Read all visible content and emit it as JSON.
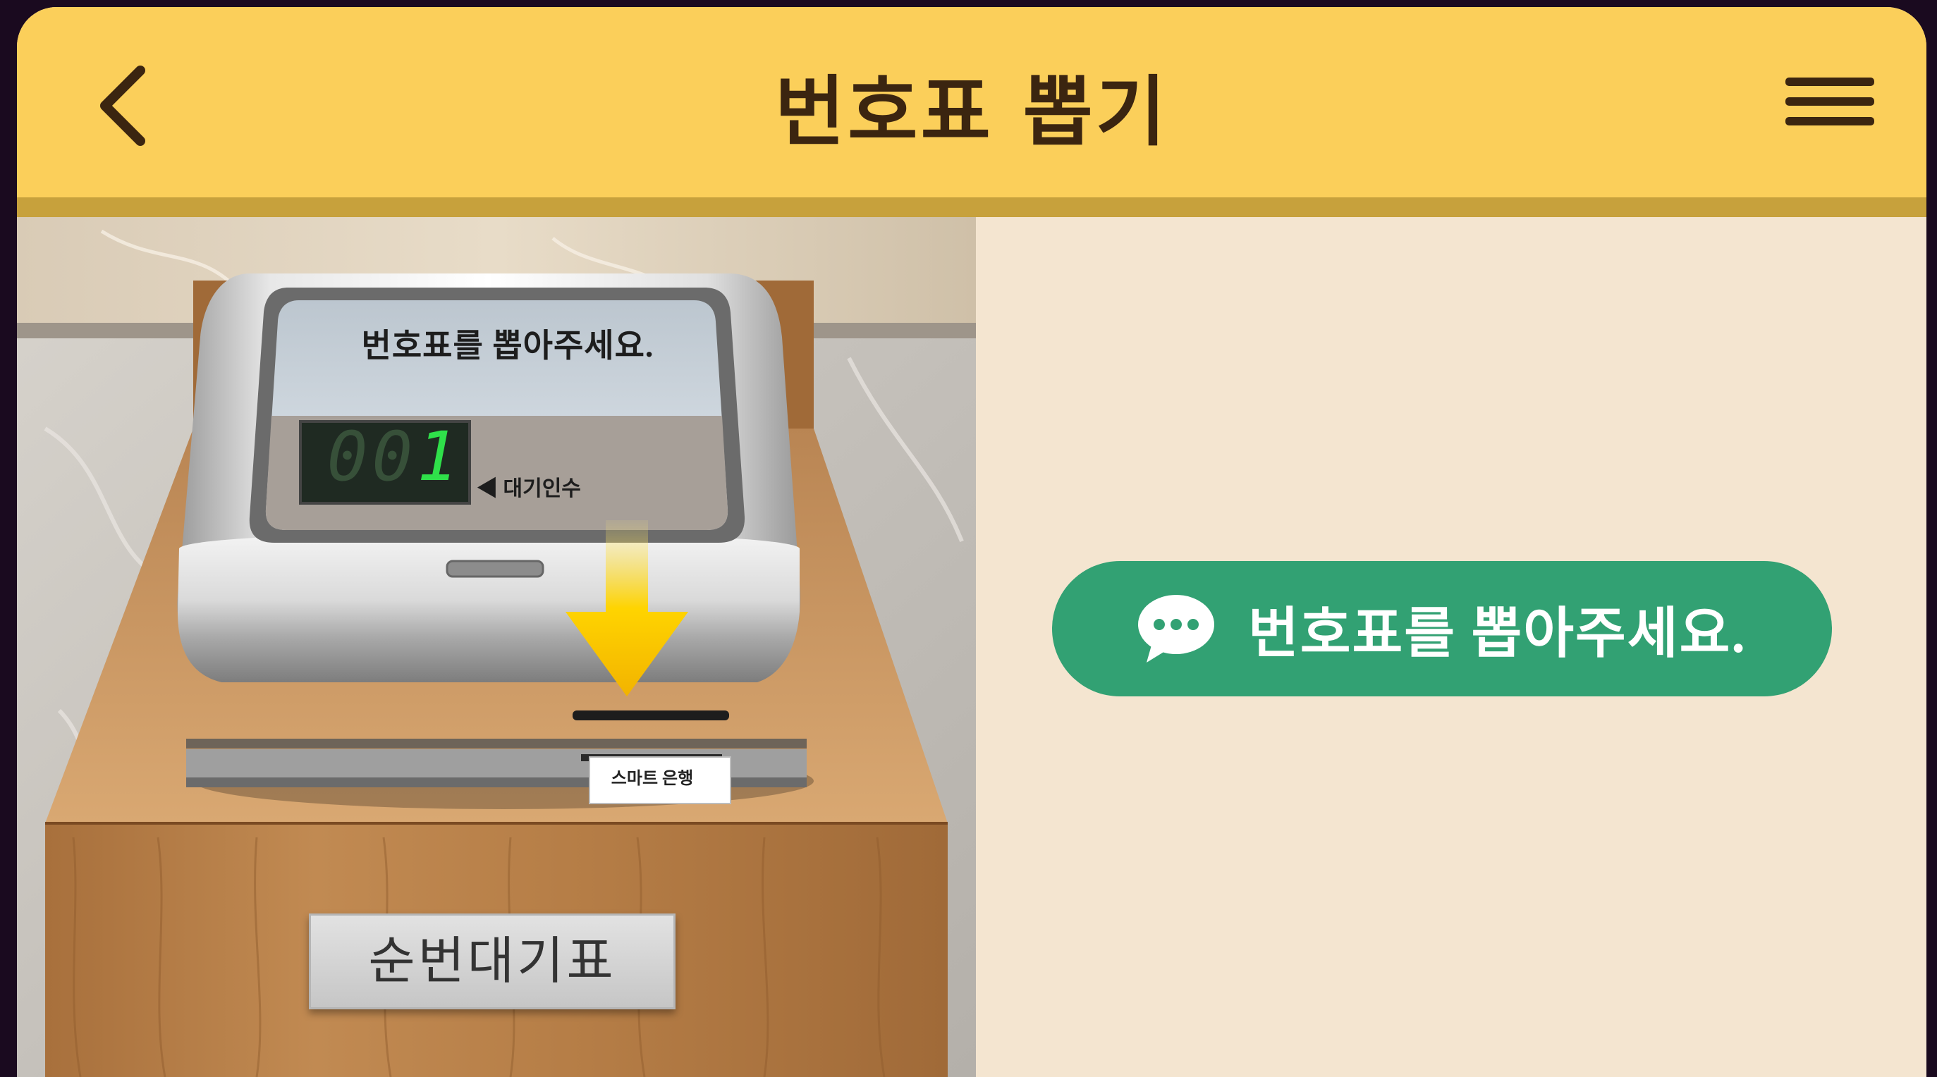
{
  "header": {
    "title": "번호표 뽑기",
    "back_icon": "chevron-left-icon",
    "menu_icon": "hamburger-menu-icon"
  },
  "kiosk": {
    "screen_message": "번호표를 뽑아주세요.",
    "waiting_count": "1",
    "waiting_label": "◀ 대기인수",
    "ticket_label": "스마트 은행",
    "plaque_label": "순번대기표",
    "arrow_icon": "down-arrow-icon"
  },
  "notice": {
    "icon": "speech-bubble-icon",
    "text": "번호표를 뽑아주세요."
  },
  "colors": {
    "header_bg": "#fbcf5a",
    "header_strip": "#c7a13c",
    "title_text": "#3b2510",
    "panel_bg": "#f4e5d0",
    "notice_bg": "#32a173",
    "lcd_digit": "#2fe04a"
  }
}
